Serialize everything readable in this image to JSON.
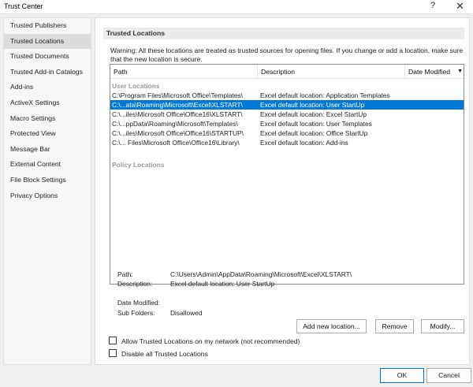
{
  "window": {
    "title": "Trust Center",
    "help": "?",
    "close": "✕"
  },
  "sidebar": {
    "items": [
      {
        "label": "Trusted Publishers"
      },
      {
        "label": "Trusted Locations"
      },
      {
        "label": "Trusted Documents"
      },
      {
        "label": "Trusted Add-in Catalogs"
      },
      {
        "label": "Add-ins"
      },
      {
        "label": "ActiveX Settings"
      },
      {
        "label": "Macro Settings"
      },
      {
        "label": "Protected View"
      },
      {
        "label": "Message Bar"
      },
      {
        "label": "External Content"
      },
      {
        "label": "File Block Settings"
      },
      {
        "label": "Privacy Options"
      }
    ],
    "active_index": 1
  },
  "main": {
    "section_title": "Trusted Locations",
    "warning": "Warning: All these locations are treated as trusted sources for opening files.  If you change or add a location, make sure that the new location is secure.",
    "columns": {
      "path": "Path",
      "description": "Description",
      "date_modified": "Date Modified"
    },
    "user_group_label": "User Locations",
    "policy_group_label": "Policy Locations",
    "user_rows": [
      {
        "path": "C:\\Program Files\\Microsoft Office\\Templates\\",
        "description": "Excel default location: Application Templates"
      },
      {
        "path": "C:\\...ata\\Roaming\\Microsoft\\Excel\\XLSTART\\",
        "description": "Excel default location: User StartUp"
      },
      {
        "path": "C:\\...iles\\Microsoft Office\\Office16\\XLSTART\\",
        "description": "Excel default location: Excel StartUp"
      },
      {
        "path": "C:\\...ppData\\Roaming\\Microsoft\\Templates\\",
        "description": "Excel default location: User Templates"
      },
      {
        "path": "C:\\...iles\\Microsoft Office\\Office16\\STARTUP\\",
        "description": "Excel default location: Office StartUp"
      },
      {
        "path": "C:\\... Files\\Microsoft Office\\Office16\\Library\\",
        "description": "Excel default location: Add-ins"
      }
    ],
    "selected_row": 1,
    "details": {
      "path_label": "Path:",
      "path_value": "C:\\Users\\Admin\\AppData\\Roaming\\Microsoft\\Excel\\XLSTART\\",
      "description_label": "Description:",
      "description_value": "Excel default location: User StartUp",
      "date_modified_label": "Date Modified:",
      "date_modified_value": "",
      "sub_folders_label": "Sub Folders:",
      "sub_folders_value": "Disallowed"
    },
    "buttons": {
      "add": "Add new location...",
      "remove": "Remove",
      "modify": "Modify..."
    },
    "checkboxes": {
      "allow_network": {
        "label": "Allow Trusted Locations on my network (not recommended)",
        "checked": false
      },
      "disable_all": {
        "label": "Disable all Trusted Locations",
        "checked": false
      }
    }
  },
  "footer": {
    "ok": "OK",
    "cancel": "Cancel"
  },
  "colors": {
    "selection": "#0078d7",
    "ok_border": "#0078d7"
  }
}
